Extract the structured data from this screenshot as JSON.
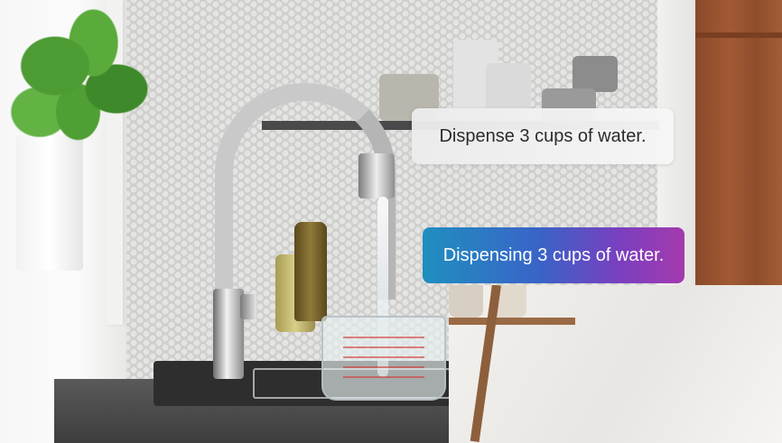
{
  "voice_dialog": {
    "user_request": "Dispense 3 cups of water.",
    "assistant_response": "Dispensing 3 cups of water."
  },
  "colors": {
    "response_gradient_start": "#1f8fbf",
    "response_gradient_end": "#a53aae",
    "request_bubble": "#ececec"
  }
}
